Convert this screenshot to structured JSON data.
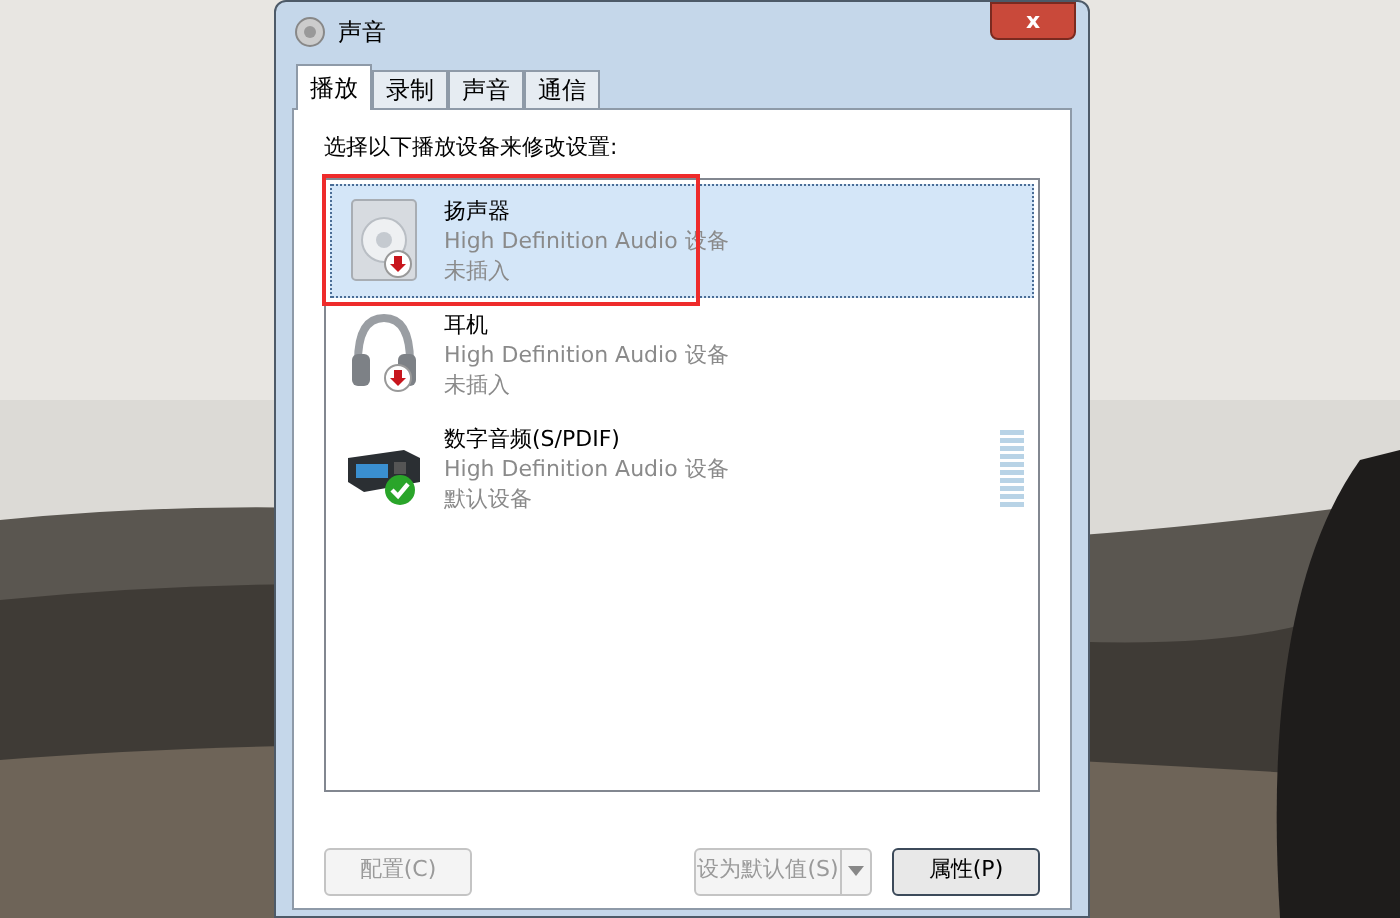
{
  "window": {
    "title": "声音",
    "close": "x"
  },
  "tabs": [
    {
      "label": "播放",
      "selected": true
    },
    {
      "label": "录制",
      "selected": false
    },
    {
      "label": "声音",
      "selected": false
    },
    {
      "label": "通信",
      "selected": false
    }
  ],
  "instruction": "选择以下播放设备来修改设置:",
  "devices": [
    {
      "kind": "speaker",
      "name": "扬声器",
      "driver": "High Definition Audio 设备",
      "status": "未插入",
      "badge": {
        "kind": "unplugged"
      },
      "selected": true,
      "highlighted": true
    },
    {
      "kind": "headphones",
      "name": "耳机",
      "driver": "High Definition Audio 设备",
      "status": "未插入",
      "badge": {
        "kind": "unplugged"
      },
      "selected": false
    },
    {
      "kind": "spdif",
      "name": "数字音频(S/PDIF)",
      "driver": "High Definition Audio 设备",
      "status": "默认设备",
      "badge": {
        "kind": "default"
      },
      "selected": false,
      "meter": true
    }
  ],
  "buttons": [
    {
      "kind": "plain",
      "label": "配置(C)",
      "disabled": true
    },
    {
      "kind": "split",
      "label": "设为默认值(S)",
      "disabled": true
    },
    {
      "kind": "default",
      "label": "属性(P)",
      "disabled": false
    }
  ]
}
